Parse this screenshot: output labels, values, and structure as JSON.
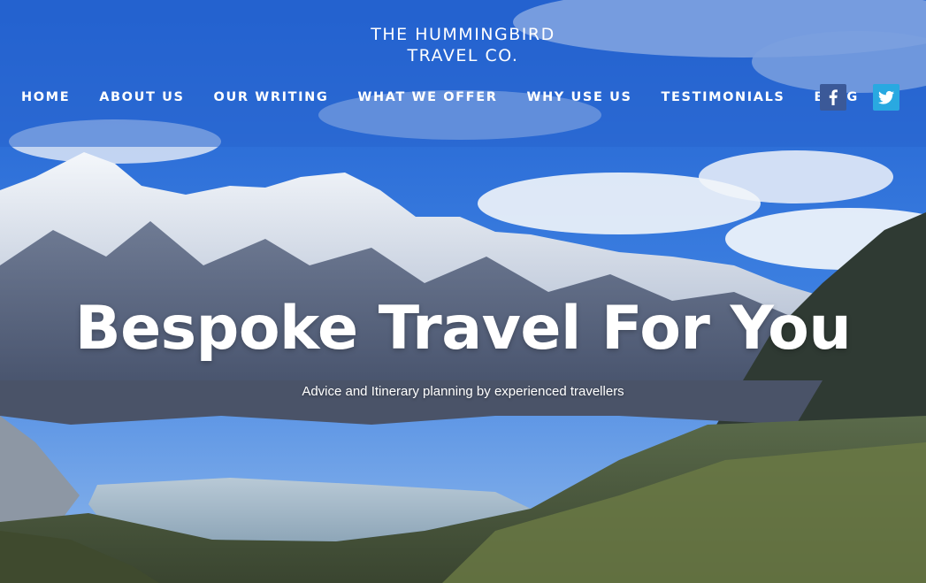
{
  "brand": {
    "line1": "THE HUMMINGBIRD",
    "line2": "TRAVEL CO."
  },
  "nav": {
    "items": [
      {
        "label": "HOME"
      },
      {
        "label": "ABOUT US"
      },
      {
        "label": "OUR WRITING"
      },
      {
        "label": "WHAT WE OFFER"
      },
      {
        "label": "WHY USE US"
      },
      {
        "label": "TESTIMONIALS"
      },
      {
        "label": "BLOG"
      }
    ]
  },
  "social": {
    "facebook_icon": "facebook-icon",
    "twitter_icon": "twitter-icon"
  },
  "hero": {
    "title": "Bespoke Travel For You",
    "subtitle": "Advice and Itinerary planning by experienced travellers",
    "background": "mountain-lake-landscape"
  },
  "colors": {
    "facebook": "#3b5998",
    "twitter": "#29a9e1",
    "header_overlay": "#2864cd"
  }
}
